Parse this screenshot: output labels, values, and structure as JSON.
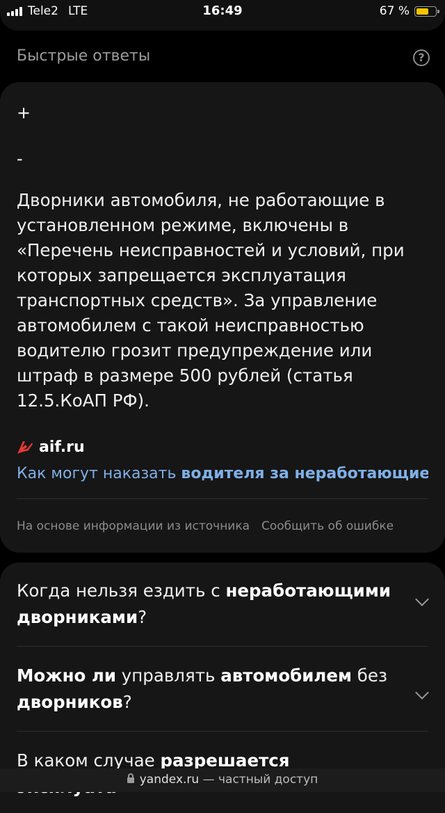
{
  "status_bar": {
    "carrier": "Tele2",
    "network": "LTE",
    "time": "16:49",
    "battery_text": "67 %",
    "battery_level": 0.67,
    "battery_color": "#f5c400"
  },
  "quick_answers": {
    "title": "Быстрые ответы",
    "help_icon": "question-icon",
    "plus": "+",
    "minus": "-",
    "answer_text": "Дворники автомобиля, не работающие в установленном режиме, включены в «Перечень неисправностей и условий, при которых запрещается эксплуатация транспортных средств». За управление автомобилем с такой неисправностью водителю грозит предупреждение или штраф в размере 500 рублей (статья 12.5.КоАП РФ).",
    "source_name": "aif.ru",
    "source_logo_color": "#e53935",
    "source_link_plain": "Как могут наказать ",
    "source_link_bold": "водителя за неработающие …",
    "footer_note": "На основе информации из источника",
    "report_error": "Сообщить об ошибке"
  },
  "faq": [
    {
      "parts": [
        {
          "t": "Когда нельзя ездить с ",
          "b": false
        },
        {
          "t": "неработающими дворниками",
          "b": true
        },
        {
          "t": "?",
          "b": false
        }
      ]
    },
    {
      "parts": [
        {
          "t": "Можно ли",
          "b": true
        },
        {
          "t": " управлять ",
          "b": false
        },
        {
          "t": "автомобилем",
          "b": true
        },
        {
          "t": " без ",
          "b": false
        },
        {
          "t": "дворников",
          "b": true
        },
        {
          "t": "?",
          "b": false
        }
      ]
    },
    {
      "parts": [
        {
          "t": "В каком случае ",
          "b": false
        },
        {
          "t": "разрешается эксплуата-",
          "b": true
        }
      ]
    }
  ],
  "bottom_bar": {
    "domain": "yandex.ru",
    "suffix": " — частный доступ"
  },
  "colors": {
    "link": "#7fb0e8",
    "card_bg": "#161616",
    "page_bg": "#000000"
  }
}
